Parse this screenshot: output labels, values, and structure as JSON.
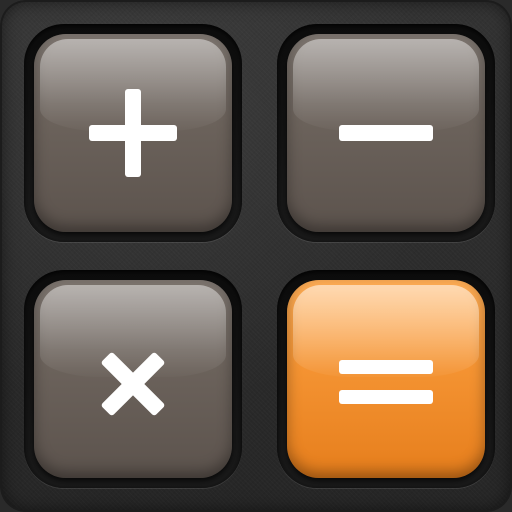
{
  "app": {
    "name": "calculator-app-icon"
  },
  "keys": [
    {
      "id": "plus",
      "icon": "plus-icon",
      "color": "#6e655e"
    },
    {
      "id": "minus",
      "icon": "minus-icon",
      "color": "#6e655e"
    },
    {
      "id": "times",
      "icon": "times-icon",
      "color": "#6e655e"
    },
    {
      "id": "equals",
      "icon": "equals-icon",
      "color": "#f49332"
    }
  ],
  "colors": {
    "background": "#2a2a2a",
    "key_dark": "#6e655e",
    "key_accent": "#f49332",
    "glyph": "#ffffff"
  }
}
